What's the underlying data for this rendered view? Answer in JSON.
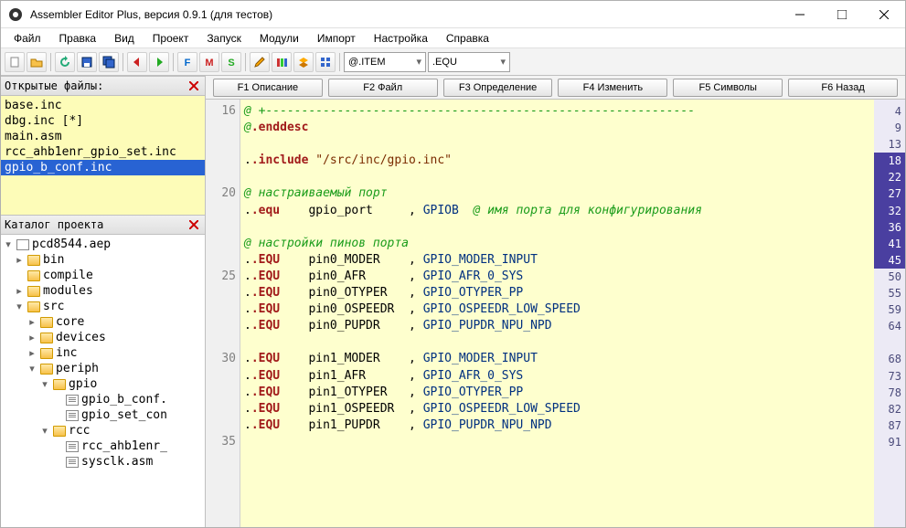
{
  "window": {
    "title": "Assembler Editor Plus, версия 0.9.1 (для тестов)"
  },
  "menu": [
    "Файл",
    "Правка",
    "Вид",
    "Проект",
    "Запуск",
    "Модули",
    "Импорт",
    "Настройка",
    "Справка"
  ],
  "toolbar_icons": [
    "new-file",
    "open-file",
    "refresh",
    "save",
    "save-all",
    "back",
    "forward",
    "f-char",
    "m-char",
    "s-char",
    "edit-pencil",
    "books",
    "layers",
    "modules"
  ],
  "combos": {
    "c1": "@.ITEM",
    "c2": ".EQU"
  },
  "fbuttons": [
    "F1 Описание",
    "F2 Файл",
    "F3 Определение",
    "F4 Изменить",
    "F5 Символы",
    "F6 Назад"
  ],
  "openfiles": {
    "header": "Открытые файлы:",
    "items": [
      {
        "label": "base.inc",
        "sel": false
      },
      {
        "label": "dbg.inc [*]",
        "sel": false
      },
      {
        "label": "main.asm",
        "sel": false
      },
      {
        "label": "rcc_ahb1enr_gpio_set.inc",
        "sel": false
      },
      {
        "label": "gpio_b_conf.inc",
        "sel": true
      }
    ]
  },
  "catalog": {
    "header": "Каталог проекта",
    "root": "pcd8544.aep",
    "nodes": [
      {
        "d": 1,
        "t": "▸",
        "i": "folder",
        "label": "bin"
      },
      {
        "d": 1,
        "t": "",
        "i": "folder",
        "label": "compile"
      },
      {
        "d": 1,
        "t": "▸",
        "i": "folder",
        "label": "modules"
      },
      {
        "d": 1,
        "t": "▾",
        "i": "folder",
        "label": "src"
      },
      {
        "d": 2,
        "t": "▸",
        "i": "folder",
        "label": "core"
      },
      {
        "d": 2,
        "t": "▸",
        "i": "folder",
        "label": "devices"
      },
      {
        "d": 2,
        "t": "▸",
        "i": "folder",
        "label": "inc"
      },
      {
        "d": 2,
        "t": "▾",
        "i": "folder",
        "label": "periph"
      },
      {
        "d": 3,
        "t": "▾",
        "i": "folder",
        "label": "gpio"
      },
      {
        "d": 4,
        "t": "",
        "i": "doc",
        "label": "gpio_b_conf."
      },
      {
        "d": 4,
        "t": "",
        "i": "doc",
        "label": "gpio_set_con"
      },
      {
        "d": 3,
        "t": "▾",
        "i": "folder",
        "label": "rcc"
      },
      {
        "d": 4,
        "t": "",
        "i": "doc",
        "label": "rcc_ahb1enr_"
      },
      {
        "d": 4,
        "t": "",
        "i": "doc",
        "label": "sysclk.asm"
      }
    ]
  },
  "left_gutter": [
    16,
    "",
    "",
    "",
    "",
    20,
    "",
    "",
    "",
    "",
    25,
    "",
    "",
    "",
    "",
    30,
    "",
    "",
    "",
    "",
    35
  ],
  "right_gutter": [
    {
      "n": 4
    },
    {
      "n": 9
    },
    {
      "n": 13
    },
    {
      "n": 18,
      "hi": true
    },
    {
      "n": 22,
      "hi": true
    },
    {
      "n": 27,
      "hi": true
    },
    {
      "n": 32,
      "hi": true
    },
    {
      "n": 36,
      "hi": true
    },
    {
      "n": 41,
      "hi": true
    },
    {
      "n": 45,
      "hi": true
    },
    {
      "n": 50
    },
    {
      "n": 55
    },
    {
      "n": 59
    },
    {
      "n": 64
    },
    {
      "n": ""
    },
    {
      "n": 68
    },
    {
      "n": 73
    },
    {
      "n": 78
    },
    {
      "n": 82
    },
    {
      "n": 87
    },
    {
      "n": 91
    }
  ],
  "code": [
    {
      "t": "cm",
      "text": "@ +------------------------------------------------------------"
    },
    {
      "t": "mix",
      "parts": [
        {
          "c": "cm",
          "s": "@"
        },
        {
          "c": "kw",
          "s": ".enddesc"
        }
      ]
    },
    {
      "t": "",
      "text": ""
    },
    {
      "t": "mix",
      "parts": [
        {
          "c": "",
          "s": "."
        },
        {
          "c": "kw",
          "s": ".include"
        },
        {
          "c": "",
          "s": " "
        },
        {
          "c": "str",
          "s": "\"/src/inc/gpio.inc\""
        }
      ]
    },
    {
      "t": "",
      "text": ""
    },
    {
      "t": "cm",
      "text": "@ настраиваемый порт"
    },
    {
      "t": "mix",
      "parts": [
        {
          "c": "",
          "s": "."
        },
        {
          "c": "kw",
          "s": ".equ"
        },
        {
          "c": "",
          "s": "    gpio_port     , "
        },
        {
          "c": "id",
          "s": "GPIOB"
        },
        {
          "c": "",
          "s": "  "
        },
        {
          "c": "cm",
          "s": "@ имя порта для конфигурирования"
        }
      ]
    },
    {
      "t": "",
      "text": ""
    },
    {
      "t": "cm",
      "text": "@ настройки пинов порта"
    },
    {
      "t": "mix",
      "parts": [
        {
          "c": "",
          "s": "."
        },
        {
          "c": "kw",
          "s": ".EQU"
        },
        {
          "c": "",
          "s": "    pin0_MODER    , "
        },
        {
          "c": "id",
          "s": "GPIO_MODER_INPUT"
        }
      ]
    },
    {
      "t": "mix",
      "parts": [
        {
          "c": "",
          "s": "."
        },
        {
          "c": "kw",
          "s": ".EQU"
        },
        {
          "c": "",
          "s": "    pin0_AFR      , "
        },
        {
          "c": "id",
          "s": "GPIO_AFR_0_SYS"
        }
      ]
    },
    {
      "t": "mix",
      "parts": [
        {
          "c": "",
          "s": "."
        },
        {
          "c": "kw",
          "s": ".EQU"
        },
        {
          "c": "",
          "s": "    pin0_OTYPER   , "
        },
        {
          "c": "id",
          "s": "GPIO_OTYPER_PP"
        }
      ]
    },
    {
      "t": "mix",
      "parts": [
        {
          "c": "",
          "s": "."
        },
        {
          "c": "kw",
          "s": ".EQU"
        },
        {
          "c": "",
          "s": "    pin0_OSPEEDR  , "
        },
        {
          "c": "id",
          "s": "GPIO_OSPEEDR_LOW_SPEED"
        }
      ]
    },
    {
      "t": "mix",
      "parts": [
        {
          "c": "",
          "s": "."
        },
        {
          "c": "kw",
          "s": ".EQU"
        },
        {
          "c": "",
          "s": "    pin0_PUPDR    , "
        },
        {
          "c": "id",
          "s": "GPIO_PUPDR_NPU_NPD"
        }
      ]
    },
    {
      "t": "",
      "text": ""
    },
    {
      "t": "mix",
      "parts": [
        {
          "c": "",
          "s": "."
        },
        {
          "c": "kw",
          "s": ".EQU"
        },
        {
          "c": "",
          "s": "    pin1_MODER    , "
        },
        {
          "c": "id",
          "s": "GPIO_MODER_INPUT"
        }
      ]
    },
    {
      "t": "mix",
      "parts": [
        {
          "c": "",
          "s": "."
        },
        {
          "c": "kw",
          "s": ".EQU"
        },
        {
          "c": "",
          "s": "    pin1_AFR      , "
        },
        {
          "c": "id",
          "s": "GPIO_AFR_0_SYS"
        }
      ]
    },
    {
      "t": "mix",
      "parts": [
        {
          "c": "",
          "s": "."
        },
        {
          "c": "kw",
          "s": ".EQU"
        },
        {
          "c": "",
          "s": "    pin1_OTYPER   , "
        },
        {
          "c": "id",
          "s": "GPIO_OTYPER_PP"
        }
      ]
    },
    {
      "t": "mix",
      "parts": [
        {
          "c": "",
          "s": "."
        },
        {
          "c": "kw",
          "s": ".EQU"
        },
        {
          "c": "",
          "s": "    pin1_OSPEEDR  , "
        },
        {
          "c": "id",
          "s": "GPIO_OSPEEDR_LOW_SPEED"
        }
      ]
    },
    {
      "t": "mix",
      "parts": [
        {
          "c": "",
          "s": "."
        },
        {
          "c": "kw",
          "s": ".EQU"
        },
        {
          "c": "",
          "s": "    pin1_PUPDR    , "
        },
        {
          "c": "id",
          "s": "GPIO_PUPDR_NPU_NPD"
        }
      ]
    }
  ]
}
